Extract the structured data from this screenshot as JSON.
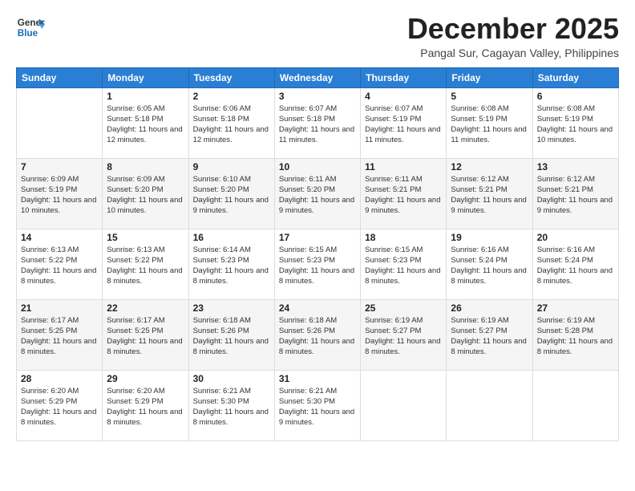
{
  "logo": {
    "line1": "General",
    "line2": "Blue"
  },
  "header": {
    "month": "December 2025",
    "location": "Pangal Sur, Cagayan Valley, Philippines"
  },
  "weekdays": [
    "Sunday",
    "Monday",
    "Tuesday",
    "Wednesday",
    "Thursday",
    "Friday",
    "Saturday"
  ],
  "weeks": [
    [
      {
        "day": "",
        "sunrise": "",
        "sunset": "",
        "daylight": ""
      },
      {
        "day": "1",
        "sunrise": "Sunrise: 6:05 AM",
        "sunset": "Sunset: 5:18 PM",
        "daylight": "Daylight: 11 hours and 12 minutes."
      },
      {
        "day": "2",
        "sunrise": "Sunrise: 6:06 AM",
        "sunset": "Sunset: 5:18 PM",
        "daylight": "Daylight: 11 hours and 12 minutes."
      },
      {
        "day": "3",
        "sunrise": "Sunrise: 6:07 AM",
        "sunset": "Sunset: 5:18 PM",
        "daylight": "Daylight: 11 hours and 11 minutes."
      },
      {
        "day": "4",
        "sunrise": "Sunrise: 6:07 AM",
        "sunset": "Sunset: 5:19 PM",
        "daylight": "Daylight: 11 hours and 11 minutes."
      },
      {
        "day": "5",
        "sunrise": "Sunrise: 6:08 AM",
        "sunset": "Sunset: 5:19 PM",
        "daylight": "Daylight: 11 hours and 11 minutes."
      },
      {
        "day": "6",
        "sunrise": "Sunrise: 6:08 AM",
        "sunset": "Sunset: 5:19 PM",
        "daylight": "Daylight: 11 hours and 10 minutes."
      }
    ],
    [
      {
        "day": "7",
        "sunrise": "Sunrise: 6:09 AM",
        "sunset": "Sunset: 5:19 PM",
        "daylight": "Daylight: 11 hours and 10 minutes."
      },
      {
        "day": "8",
        "sunrise": "Sunrise: 6:09 AM",
        "sunset": "Sunset: 5:20 PM",
        "daylight": "Daylight: 11 hours and 10 minutes."
      },
      {
        "day": "9",
        "sunrise": "Sunrise: 6:10 AM",
        "sunset": "Sunset: 5:20 PM",
        "daylight": "Daylight: 11 hours and 9 minutes."
      },
      {
        "day": "10",
        "sunrise": "Sunrise: 6:11 AM",
        "sunset": "Sunset: 5:20 PM",
        "daylight": "Daylight: 11 hours and 9 minutes."
      },
      {
        "day": "11",
        "sunrise": "Sunrise: 6:11 AM",
        "sunset": "Sunset: 5:21 PM",
        "daylight": "Daylight: 11 hours and 9 minutes."
      },
      {
        "day": "12",
        "sunrise": "Sunrise: 6:12 AM",
        "sunset": "Sunset: 5:21 PM",
        "daylight": "Daylight: 11 hours and 9 minutes."
      },
      {
        "day": "13",
        "sunrise": "Sunrise: 6:12 AM",
        "sunset": "Sunset: 5:21 PM",
        "daylight": "Daylight: 11 hours and 9 minutes."
      }
    ],
    [
      {
        "day": "14",
        "sunrise": "Sunrise: 6:13 AM",
        "sunset": "Sunset: 5:22 PM",
        "daylight": "Daylight: 11 hours and 8 minutes."
      },
      {
        "day": "15",
        "sunrise": "Sunrise: 6:13 AM",
        "sunset": "Sunset: 5:22 PM",
        "daylight": "Daylight: 11 hours and 8 minutes."
      },
      {
        "day": "16",
        "sunrise": "Sunrise: 6:14 AM",
        "sunset": "Sunset: 5:23 PM",
        "daylight": "Daylight: 11 hours and 8 minutes."
      },
      {
        "day": "17",
        "sunrise": "Sunrise: 6:15 AM",
        "sunset": "Sunset: 5:23 PM",
        "daylight": "Daylight: 11 hours and 8 minutes."
      },
      {
        "day": "18",
        "sunrise": "Sunrise: 6:15 AM",
        "sunset": "Sunset: 5:23 PM",
        "daylight": "Daylight: 11 hours and 8 minutes."
      },
      {
        "day": "19",
        "sunrise": "Sunrise: 6:16 AM",
        "sunset": "Sunset: 5:24 PM",
        "daylight": "Daylight: 11 hours and 8 minutes."
      },
      {
        "day": "20",
        "sunrise": "Sunrise: 6:16 AM",
        "sunset": "Sunset: 5:24 PM",
        "daylight": "Daylight: 11 hours and 8 minutes."
      }
    ],
    [
      {
        "day": "21",
        "sunrise": "Sunrise: 6:17 AM",
        "sunset": "Sunset: 5:25 PM",
        "daylight": "Daylight: 11 hours and 8 minutes."
      },
      {
        "day": "22",
        "sunrise": "Sunrise: 6:17 AM",
        "sunset": "Sunset: 5:25 PM",
        "daylight": "Daylight: 11 hours and 8 minutes."
      },
      {
        "day": "23",
        "sunrise": "Sunrise: 6:18 AM",
        "sunset": "Sunset: 5:26 PM",
        "daylight": "Daylight: 11 hours and 8 minutes."
      },
      {
        "day": "24",
        "sunrise": "Sunrise: 6:18 AM",
        "sunset": "Sunset: 5:26 PM",
        "daylight": "Daylight: 11 hours and 8 minutes."
      },
      {
        "day": "25",
        "sunrise": "Sunrise: 6:19 AM",
        "sunset": "Sunset: 5:27 PM",
        "daylight": "Daylight: 11 hours and 8 minutes."
      },
      {
        "day": "26",
        "sunrise": "Sunrise: 6:19 AM",
        "sunset": "Sunset: 5:27 PM",
        "daylight": "Daylight: 11 hours and 8 minutes."
      },
      {
        "day": "27",
        "sunrise": "Sunrise: 6:19 AM",
        "sunset": "Sunset: 5:28 PM",
        "daylight": "Daylight: 11 hours and 8 minutes."
      }
    ],
    [
      {
        "day": "28",
        "sunrise": "Sunrise: 6:20 AM",
        "sunset": "Sunset: 5:29 PM",
        "daylight": "Daylight: 11 hours and 8 minutes."
      },
      {
        "day": "29",
        "sunrise": "Sunrise: 6:20 AM",
        "sunset": "Sunset: 5:29 PM",
        "daylight": "Daylight: 11 hours and 8 minutes."
      },
      {
        "day": "30",
        "sunrise": "Sunrise: 6:21 AM",
        "sunset": "Sunset: 5:30 PM",
        "daylight": "Daylight: 11 hours and 8 minutes."
      },
      {
        "day": "31",
        "sunrise": "Sunrise: 6:21 AM",
        "sunset": "Sunset: 5:30 PM",
        "daylight": "Daylight: 11 hours and 9 minutes."
      },
      {
        "day": "",
        "sunrise": "",
        "sunset": "",
        "daylight": ""
      },
      {
        "day": "",
        "sunrise": "",
        "sunset": "",
        "daylight": ""
      },
      {
        "day": "",
        "sunrise": "",
        "sunset": "",
        "daylight": ""
      }
    ]
  ]
}
